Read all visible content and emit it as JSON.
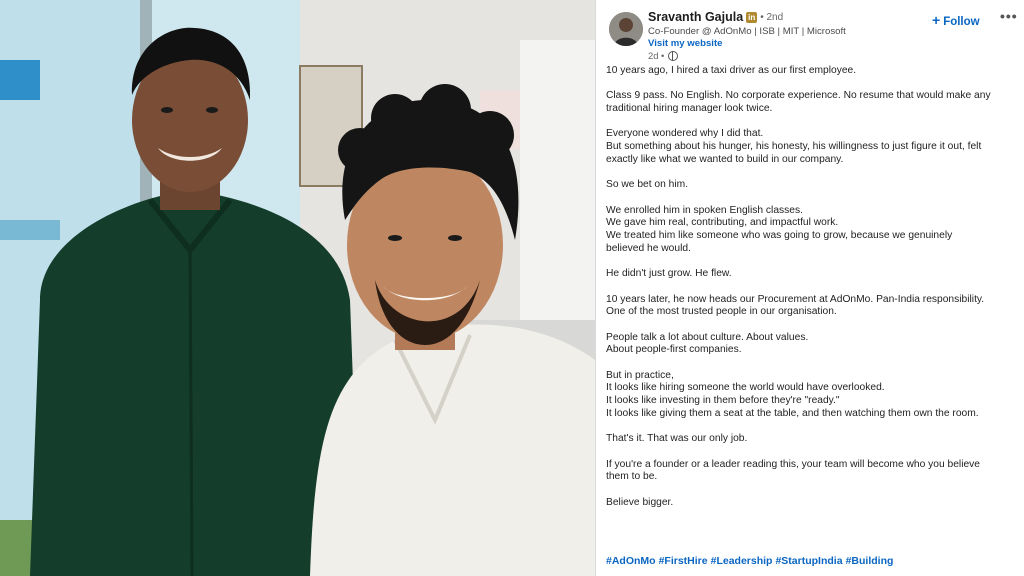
{
  "post": {
    "author_name": "Sravanth Gajula",
    "profile_badge": "in",
    "connection_degree": "• 2nd",
    "headline": "Co-Founder @ AdOnMo | ISB | MIT | Microsoft",
    "website_link": "Visit my website",
    "timestamp": "2d •",
    "follow_label": "Follow",
    "more_label": "•••",
    "paragraphs": [
      [
        "10 years ago, I hired a taxi driver as our first employee."
      ],
      [
        "Class 9 pass. No English. No corporate experience. No resume that would make any",
        "traditional hiring manager look twice."
      ],
      [
        "Everyone wondered why I did that.",
        "But something about his hunger, his honesty, his willingness to just figure it out, felt",
        "exactly like what we wanted to build in our company."
      ],
      [
        "So we bet on him."
      ],
      [
        "We enrolled him in spoken English classes.",
        "We gave him real, contributing, and impactful work.",
        "We treated him like someone who was going to grow, because we genuinely",
        "believed he would."
      ],
      [
        "He didn't just grow. He flew."
      ],
      [
        "10 years later, he now heads our Procurement at AdOnMo. Pan-India responsibility.",
        "One of the most trusted people in our organisation."
      ],
      [
        "People talk a lot about culture. About values.",
        "About people-first companies."
      ],
      [
        "But in practice,",
        "It looks like hiring someone the world would have overlooked.",
        "It looks like investing in them before they're \"ready.\"",
        "It looks like giving them a seat at the table, and then watching them own the room."
      ],
      [
        "That's it. That was our only job."
      ],
      [
        "If you're a founder or a leader reading this, your team will become who you believe",
        "them to be."
      ],
      [
        "Believe bigger."
      ]
    ],
    "hashtags": [
      "#AdOnMo",
      "#FirstHire",
      "#Leadership",
      "#StartupIndia",
      "#Building"
    ]
  },
  "photo": {
    "description_icon": "photo-of-two-men",
    "colors": {
      "green_shirt": "#12402b",
      "white_shirt": "#f2f0ea",
      "wall": "#e3e6e7",
      "glass": "#c9e6ee"
    }
  },
  "colors": {
    "link_blue": "#0a66c2",
    "text": "#1f1f1f",
    "muted": "#666666"
  }
}
